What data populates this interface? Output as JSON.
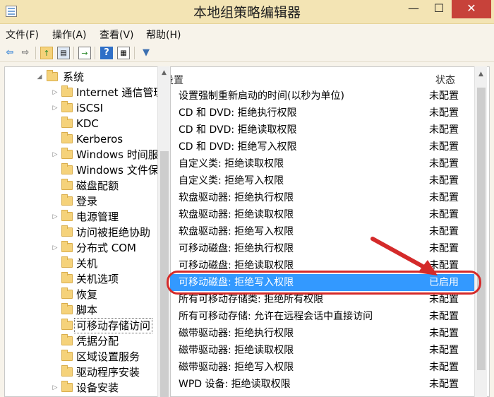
{
  "window": {
    "title": "本地组策略编辑器",
    "minimize": "—",
    "maximize": "☐",
    "close": "✕"
  },
  "menu": {
    "file": "文件(F)",
    "action": "操作(A)",
    "view": "查看(V)",
    "help": "帮助(H)"
  },
  "toolbar": {
    "icons": [
      "back-icon",
      "forward-icon",
      "up-folder-icon",
      "show-hide-tree-icon",
      "export-list-icon",
      "help-icon",
      "properties-icon",
      "filter-icon"
    ]
  },
  "tree": {
    "items": [
      {
        "label": "系统",
        "expander": "◢"
      },
      {
        "label": "Internet 通信管理",
        "expander": "▷"
      },
      {
        "label": "iSCSI",
        "expander": "▷"
      },
      {
        "label": "KDC",
        "expander": ""
      },
      {
        "label": "Kerberos",
        "expander": ""
      },
      {
        "label": "Windows 时间服务",
        "expander": "▷"
      },
      {
        "label": "Windows 文件保护",
        "expander": ""
      },
      {
        "label": "磁盘配额",
        "expander": ""
      },
      {
        "label": "登录",
        "expander": ""
      },
      {
        "label": "电源管理",
        "expander": "▷"
      },
      {
        "label": "访问被拒绝协助",
        "expander": ""
      },
      {
        "label": "分布式 COM",
        "expander": "▷"
      },
      {
        "label": "关机",
        "expander": ""
      },
      {
        "label": "关机选项",
        "expander": ""
      },
      {
        "label": "恢复",
        "expander": ""
      },
      {
        "label": "脚本",
        "expander": ""
      },
      {
        "label": "可移动存储访问",
        "expander": ""
      },
      {
        "label": "凭据分配",
        "expander": ""
      },
      {
        "label": "区域设置服务",
        "expander": ""
      },
      {
        "label": "驱动程序安装",
        "expander": ""
      },
      {
        "label": "设备安装",
        "expander": "▷"
      }
    ]
  },
  "list": {
    "header": {
      "setting": "设置",
      "state": "状态"
    },
    "rows": [
      {
        "setting": "设置强制重新启动的时间(以秒为单位)",
        "state": "未配置"
      },
      {
        "setting": "CD 和 DVD: 拒绝执行权限",
        "state": "未配置"
      },
      {
        "setting": "CD 和 DVD: 拒绝读取权限",
        "state": "未配置"
      },
      {
        "setting": "CD 和 DVD: 拒绝写入权限",
        "state": "未配置"
      },
      {
        "setting": "自定义类: 拒绝读取权限",
        "state": "未配置"
      },
      {
        "setting": "自定义类: 拒绝写入权限",
        "state": "未配置"
      },
      {
        "setting": "软盘驱动器: 拒绝执行权限",
        "state": "未配置"
      },
      {
        "setting": "软盘驱动器: 拒绝读取权限",
        "state": "未配置"
      },
      {
        "setting": "软盘驱动器: 拒绝写入权限",
        "state": "未配置"
      },
      {
        "setting": "可移动磁盘: 拒绝执行权限",
        "state": "未配置"
      },
      {
        "setting": "可移动磁盘: 拒绝读取权限",
        "state": "未配置"
      },
      {
        "setting": "可移动磁盘: 拒绝写入权限",
        "state": "已启用"
      },
      {
        "setting": "所有可移动存储类: 拒绝所有权限",
        "state": "未配置"
      },
      {
        "setting": "所有可移动存储: 允许在远程会话中直接访问",
        "state": "未配置"
      },
      {
        "setting": "磁带驱动器: 拒绝执行权限",
        "state": "未配置"
      },
      {
        "setting": "磁带驱动器: 拒绝读取权限",
        "state": "未配置"
      },
      {
        "setting": "磁带驱动器: 拒绝写入权限",
        "state": "未配置"
      },
      {
        "setting": "WPD 设备: 拒绝读取权限",
        "state": "未配置"
      }
    ]
  },
  "colors": {
    "selection": "#3399ff",
    "annotation": "#d42a2a",
    "titlebar": "#f3e4b4"
  }
}
